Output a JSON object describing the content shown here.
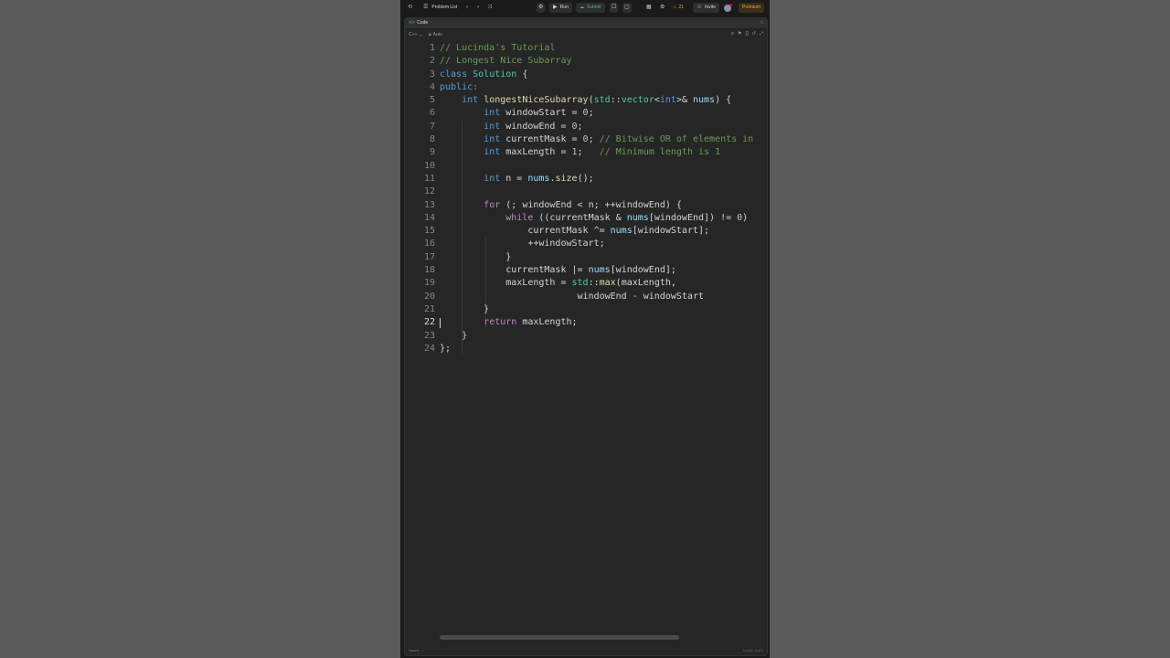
{
  "topbar": {
    "problem_list": "Problem List",
    "run": "Run",
    "submit": "Submit",
    "streak": "21",
    "invite": "Invite",
    "premium": "Premium"
  },
  "panel": {
    "tab_label": "Code",
    "language": "C++",
    "auto": "Auto"
  },
  "code_lines": [
    {
      "n": "1"
    },
    {
      "n": "2"
    },
    {
      "n": "3"
    },
    {
      "n": "4"
    },
    {
      "n": "5"
    },
    {
      "n": "6"
    },
    {
      "n": "7"
    },
    {
      "n": "8"
    },
    {
      "n": "9"
    },
    {
      "n": "10"
    },
    {
      "n": "11"
    },
    {
      "n": "12"
    },
    {
      "n": "13"
    },
    {
      "n": "14"
    },
    {
      "n": "15"
    },
    {
      "n": "16"
    },
    {
      "n": "17"
    },
    {
      "n": "18"
    },
    {
      "n": "19"
    },
    {
      "n": "20"
    },
    {
      "n": "21"
    },
    {
      "n": "22"
    },
    {
      "n": "23"
    },
    {
      "n": "24"
    }
  ],
  "code": {
    "l1": "// Lucinda's Tutorial",
    "l2": "// Longest Nice Subarray",
    "l3_kw": "class",
    "l3_name": "Solution",
    "l3_rest": " {",
    "l4": "public:",
    "l5_int": "int",
    "l5_fn": "longestNiceSubarray",
    "l5_p1": "(",
    "l5_std": "std",
    "l5_p2": "::",
    "l5_vec": "vector",
    "l5_p3": "<",
    "l5_int2": "int",
    "l5_p4": ">& ",
    "l5_nums": "nums",
    "l5_p5": ") {",
    "l6_int": "int",
    "l6_rest": " windowStart = ",
    "l6_num": "0",
    "l6_end": ";",
    "l7_int": "int",
    "l7_rest": " windowEnd = ",
    "l7_num": "0",
    "l7_end": ";",
    "l8_int": "int",
    "l8_rest": " currentMask = ",
    "l8_num": "0",
    "l8_end": "; ",
    "l8_cm": "// Bitwise OR of elements in",
    "l9_int": "int",
    "l9_rest": " maxLength = ",
    "l9_num": "1",
    "l9_end": ";   ",
    "l9_cm": "// Minimum length is 1",
    "l11_int": "int",
    "l11_rest": " n = ",
    "l11_nums": "nums",
    "l11_dot": ".",
    "l11_fn": "size",
    "l11_end": "();",
    "l13_for": "for",
    "l13_rest": " (; windowEnd < n; ++windowEnd) {",
    "l14_while": "while",
    "l14_a": " ((currentMask & ",
    "l14_nums": "nums",
    "l14_b": "[windowEnd]) != ",
    "l14_num": "0",
    "l14_c": ")",
    "l15_a": "currentMask ^= ",
    "l15_nums": "nums",
    "l15_b": "[windowStart];",
    "l16": "++windowStart;",
    "l17": "}",
    "l18_a": "currentMask |= ",
    "l18_nums": "nums",
    "l18_b": "[windowEnd];",
    "l19_a": "maxLength = ",
    "l19_std": "std",
    "l19_b": "::",
    "l19_fn": "max",
    "l19_c": "(maxLength,",
    "l20": "windowEnd - windowStart",
    "l21": "}",
    "l22_ret": "return",
    "l22_rest": " maxLength;",
    "l23": "}",
    "l24": "};"
  },
  "footer": {
    "left": "Saved",
    "right": "Ln 22, Col 1"
  }
}
